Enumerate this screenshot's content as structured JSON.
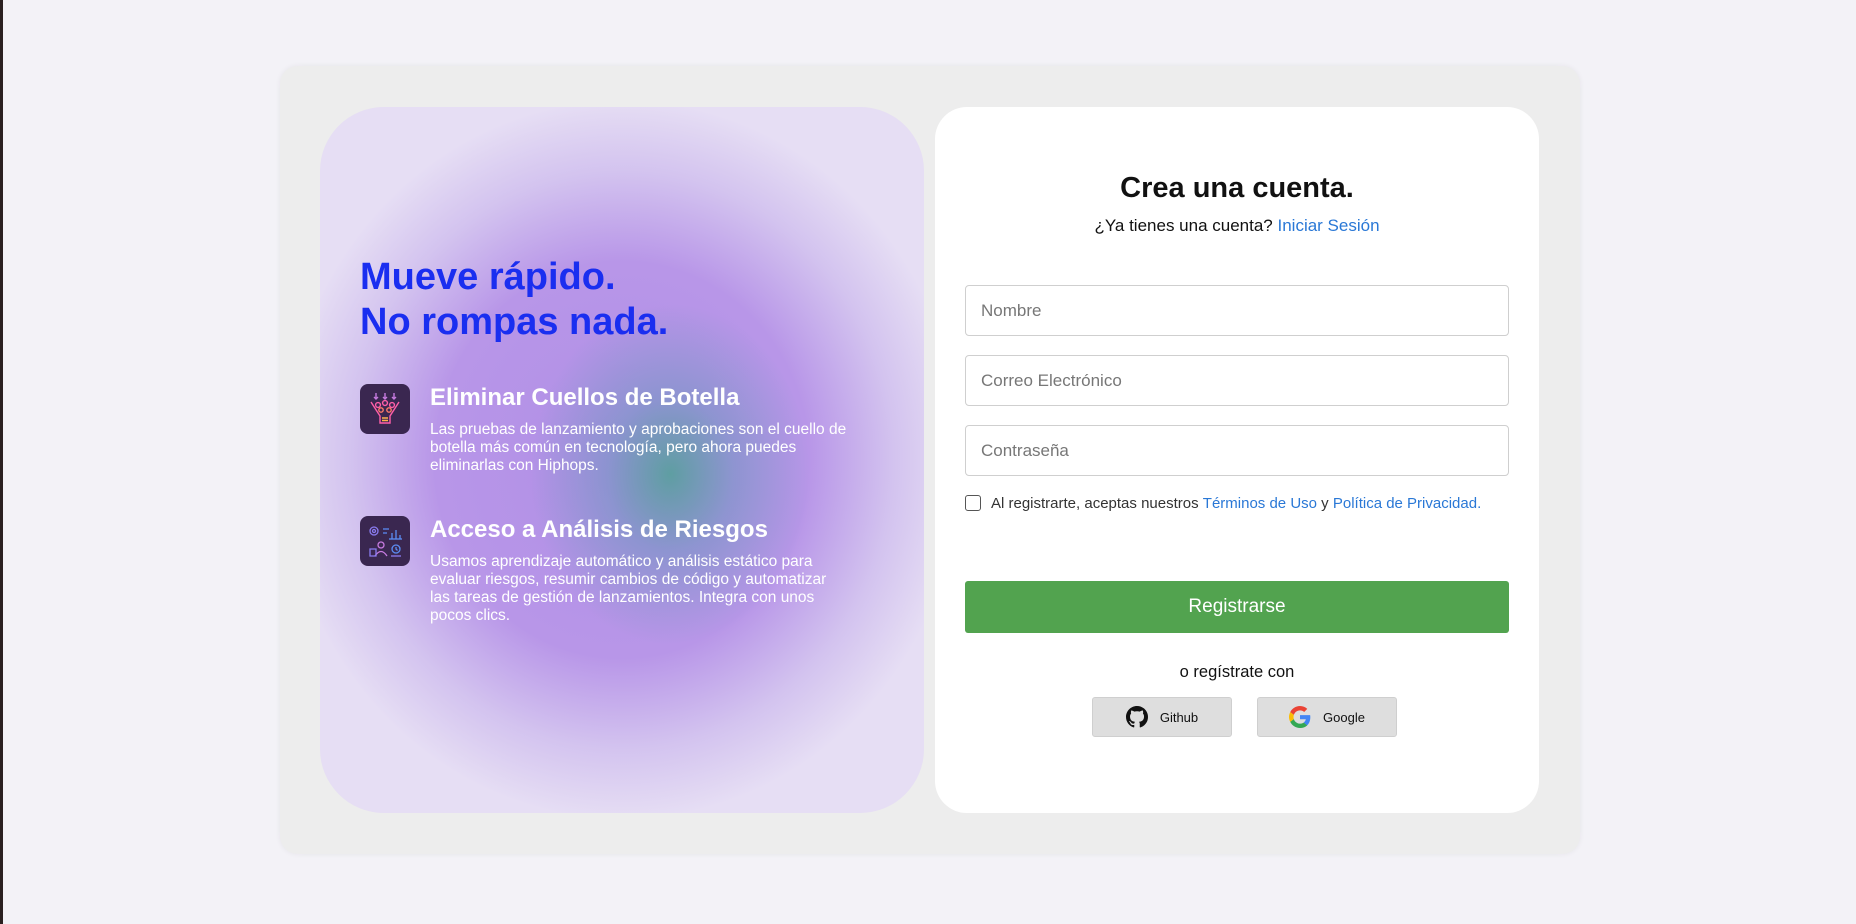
{
  "promo": {
    "headline_line1": "Mueve rápido.",
    "headline_line2": "No rompas nada.",
    "features": [
      {
        "icon": "bottleneck-funnel-icon",
        "title": "Eliminar Cuellos de Botella",
        "description": "Las pruebas de lanzamiento y aprobaciones son el cuello de botella más común en tecnología, pero ahora puedes eliminarlas con Hiphops."
      },
      {
        "icon": "risk-analytics-icon",
        "title": "Acceso a Análisis de Riesgos",
        "description": "Usamos aprendizaje automático y análisis estático para evaluar riesgos, resumir cambios de código y automatizar las tareas de gestión de lanzamientos. Integra con unos pocos clics."
      }
    ]
  },
  "form": {
    "title": "Crea una cuenta.",
    "login_prompt": "¿Ya tienes una cuenta?",
    "login_link": "Iniciar Sesión",
    "name_placeholder": "Nombre",
    "email_placeholder": "Correo Electrónico",
    "password_placeholder": "Contraseña",
    "terms_prefix": "Al registrarte, aceptas nuestros",
    "terms_link": "Términos de Uso",
    "terms_and": "y",
    "privacy_link": "Política de Privacidad",
    "terms_suffix": ".",
    "terms_checked": false,
    "submit_label": "Registrarse",
    "alt_signup": "o regístrate con",
    "github_label": "Github",
    "google_label": "Google"
  },
  "colors": {
    "headline": "#1a2ef0",
    "link": "#2a78d6",
    "submit": "#52a34f",
    "page_bg": "#f3f2f7"
  }
}
